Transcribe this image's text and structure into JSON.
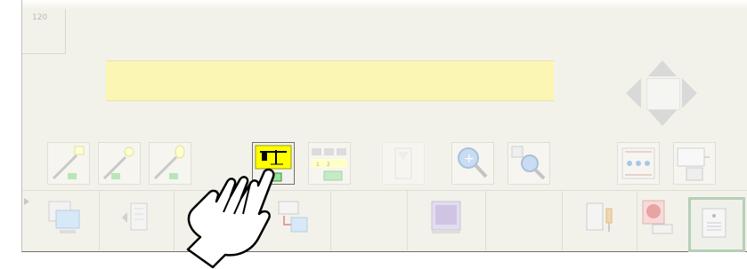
{
  "counter": {
    "value": "120"
  },
  "message_bar": {
    "text": ""
  },
  "toolbar": {
    "tools": [
      {
        "name": "draw-line-square-tool"
      },
      {
        "name": "draw-line-circle-tool"
      },
      {
        "name": "draw-line-ellipse-tool"
      },
      {
        "name": "circuit-diagram-tool",
        "active": true
      },
      {
        "name": "ladder-columns-tool",
        "labels": [
          "1",
          "2"
        ]
      },
      {
        "name": "disabled-tool"
      },
      {
        "name": "zoom-in-tool"
      },
      {
        "name": "zoom-out-tool"
      },
      {
        "name": "network-nodes-tool"
      },
      {
        "name": "window-layout-tool"
      }
    ]
  },
  "bottom_bar": {
    "buttons": [
      "monitor-program-button",
      "back-program-button",
      "transfer-program-button",
      "screen-preview-button",
      "io-device-button",
      "stop-device-button",
      "panel-button"
    ]
  },
  "colors": {
    "panel_bg": "#f3f2ea",
    "message_bg": "#fbf6b3",
    "active_tool_bg": "#ffff00",
    "selected_outline": "#b6cfb6"
  }
}
